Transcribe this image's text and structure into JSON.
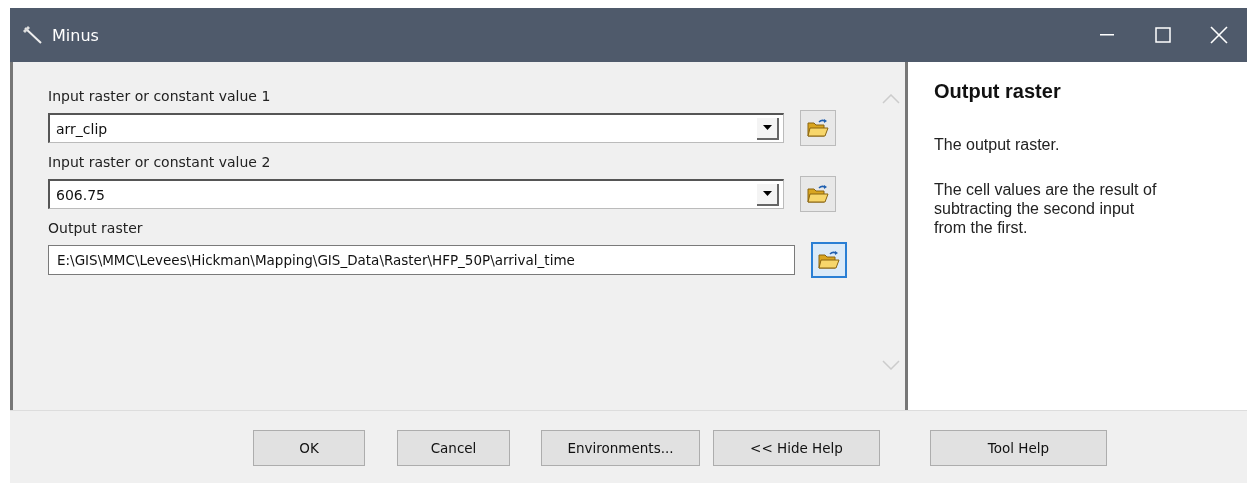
{
  "window": {
    "title": "Minus"
  },
  "parameters": [
    {
      "label": "Input raster or constant value 1",
      "kind": "dropdown",
      "value": "arr_clip",
      "browse_focused": false
    },
    {
      "label": "Input raster or constant value 2",
      "kind": "dropdown",
      "value": "606.75",
      "browse_focused": false
    },
    {
      "label": "Output raster",
      "kind": "text",
      "value": "E:\\GIS\\MMC\\Levees\\Hickman\\Mapping\\GIS_Data\\Raster\\HFP_50P\\arrival_time",
      "browse_focused": true
    }
  ],
  "help": {
    "title": "Output raster",
    "paragraphs": [
      "The output raster.",
      "The cell values are the result of subtracting the second input from the first."
    ]
  },
  "buttons": [
    "OK",
    "Cancel",
    "Environments...",
    "<< Hide Help",
    "Tool Help"
  ]
}
